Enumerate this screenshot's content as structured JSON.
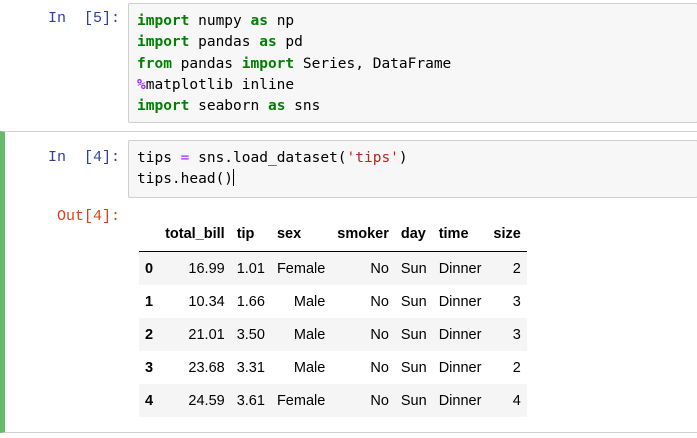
{
  "cells": [
    {
      "prompt": "In  [5]:",
      "lines": [
        [
          {
            "t": "import",
            "k": "kw"
          },
          {
            "t": " numpy "
          },
          {
            "t": "as",
            "k": "kw"
          },
          {
            "t": " np"
          }
        ],
        [
          {
            "t": "import",
            "k": "kw"
          },
          {
            "t": " pandas "
          },
          {
            "t": "as",
            "k": "kw"
          },
          {
            "t": " pd"
          }
        ],
        [
          {
            "t": "from",
            "k": "kw"
          },
          {
            "t": " pandas "
          },
          {
            "t": "import",
            "k": "kw"
          },
          {
            "t": " Series, DataFrame"
          }
        ],
        [
          {
            "t": "%",
            "k": "mg"
          },
          {
            "t": "matplotlib inline"
          }
        ],
        [
          {
            "t": "import",
            "k": "kw"
          },
          {
            "t": " seaborn "
          },
          {
            "t": "as",
            "k": "kw"
          },
          {
            "t": " sns"
          }
        ]
      ]
    },
    {
      "prompt": "In  [4]:",
      "lines": [
        [
          {
            "t": "tips "
          },
          {
            "t": "=",
            "k": "op"
          },
          {
            "t": " sns.load_dataset("
          },
          {
            "t": "'tips'",
            "k": "st"
          },
          {
            "t": ")"
          }
        ],
        [
          {
            "t": "tips.head()"
          }
        ]
      ],
      "output_prompt": "Out[4]:"
    }
  ],
  "dataframe": {
    "columns": [
      "total_bill",
      "tip",
      "sex",
      "smoker",
      "day",
      "time",
      "size"
    ],
    "rows": [
      {
        "index": "0",
        "values": [
          "16.99",
          "1.01",
          "Female",
          "No",
          "Sun",
          "Dinner",
          "2"
        ]
      },
      {
        "index": "1",
        "values": [
          "10.34",
          "1.66",
          "Male",
          "No",
          "Sun",
          "Dinner",
          "3"
        ]
      },
      {
        "index": "2",
        "values": [
          "21.01",
          "3.50",
          "Male",
          "No",
          "Sun",
          "Dinner",
          "3"
        ]
      },
      {
        "index": "3",
        "values": [
          "23.68",
          "3.31",
          "Male",
          "No",
          "Sun",
          "Dinner",
          "2"
        ]
      },
      {
        "index": "4",
        "values": [
          "24.59",
          "3.61",
          "Female",
          "No",
          "Sun",
          "Dinner",
          "4"
        ]
      }
    ]
  },
  "colors": {
    "keyword": "#008000",
    "magic": "#aa22ff",
    "string": "#ba2121",
    "in_prompt": "#303f9f",
    "out_prompt": "#d84315",
    "selected_cell_bar": "#66bb6a"
  }
}
